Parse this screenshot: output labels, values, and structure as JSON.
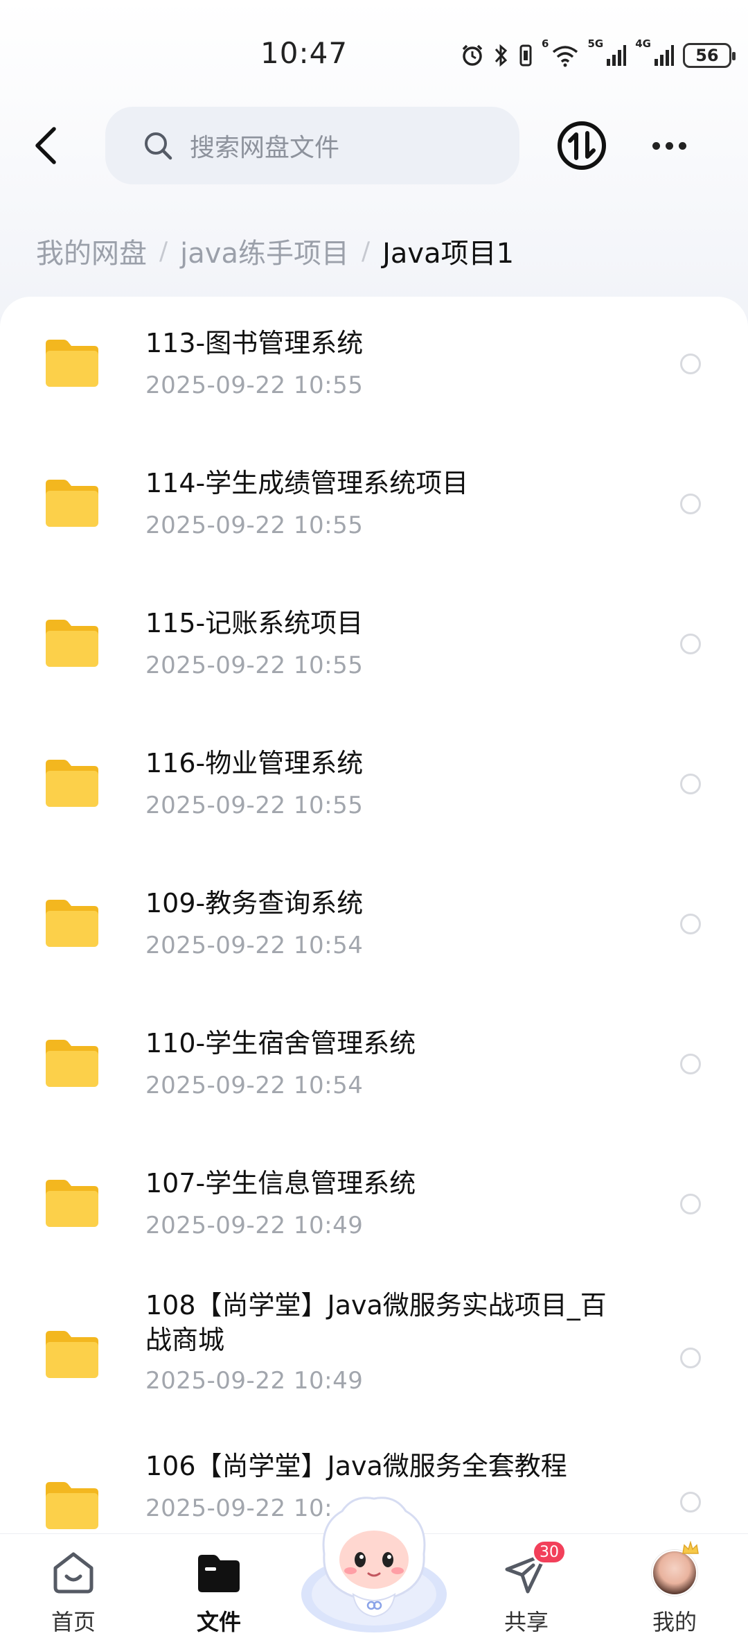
{
  "status_bar": {
    "time": "10:47",
    "battery": "56",
    "net_5g": "5G",
    "net_4g": "4G",
    "wifi_tag": "6"
  },
  "search": {
    "placeholder": "搜索网盘文件"
  },
  "breadcrumb": [
    {
      "label": "我的网盘"
    },
    {
      "label": "java练手项目"
    },
    {
      "label": "Java项目1"
    }
  ],
  "breadcrumb_separator": "/",
  "files": [
    {
      "name": "113-图书管理系统",
      "time": "2025-09-22  10:55"
    },
    {
      "name": "114-学生成绩管理系统项目",
      "time": "2025-09-22  10:55"
    },
    {
      "name": "115-记账系统项目",
      "time": "2025-09-22  10:55"
    },
    {
      "name": "116-物业管理系统",
      "time": "2025-09-22  10:55"
    },
    {
      "name": "109-教务查询系统",
      "time": "2025-09-22  10:54"
    },
    {
      "name": "110-学生宿舍管理系统",
      "time": "2025-09-22  10:54"
    },
    {
      "name": "107-学生信息管理系统",
      "time": "2025-09-22  10:49"
    },
    {
      "name": "108【尚学堂】Java微服务实战项目_百战商城",
      "time": "2025-09-22  10:49"
    },
    {
      "name": "106【尚学堂】Java微服务全套教程",
      "time": "2025-09-22  10:"
    }
  ],
  "nav": {
    "home": "首页",
    "files": "文件",
    "share": "共享",
    "share_badge": "30",
    "mine": "我的"
  },
  "colors": {
    "folder": "#fcd04a",
    "badge": "#f2405a",
    "search_bg": "#edf0f6",
    "meta_text": "#a2a6ad"
  },
  "icons": [
    "back-icon",
    "search-icon",
    "transfer-icon",
    "more-icon",
    "folder-icon",
    "home-icon",
    "files-icon",
    "share-icon",
    "mascot-icon"
  ]
}
